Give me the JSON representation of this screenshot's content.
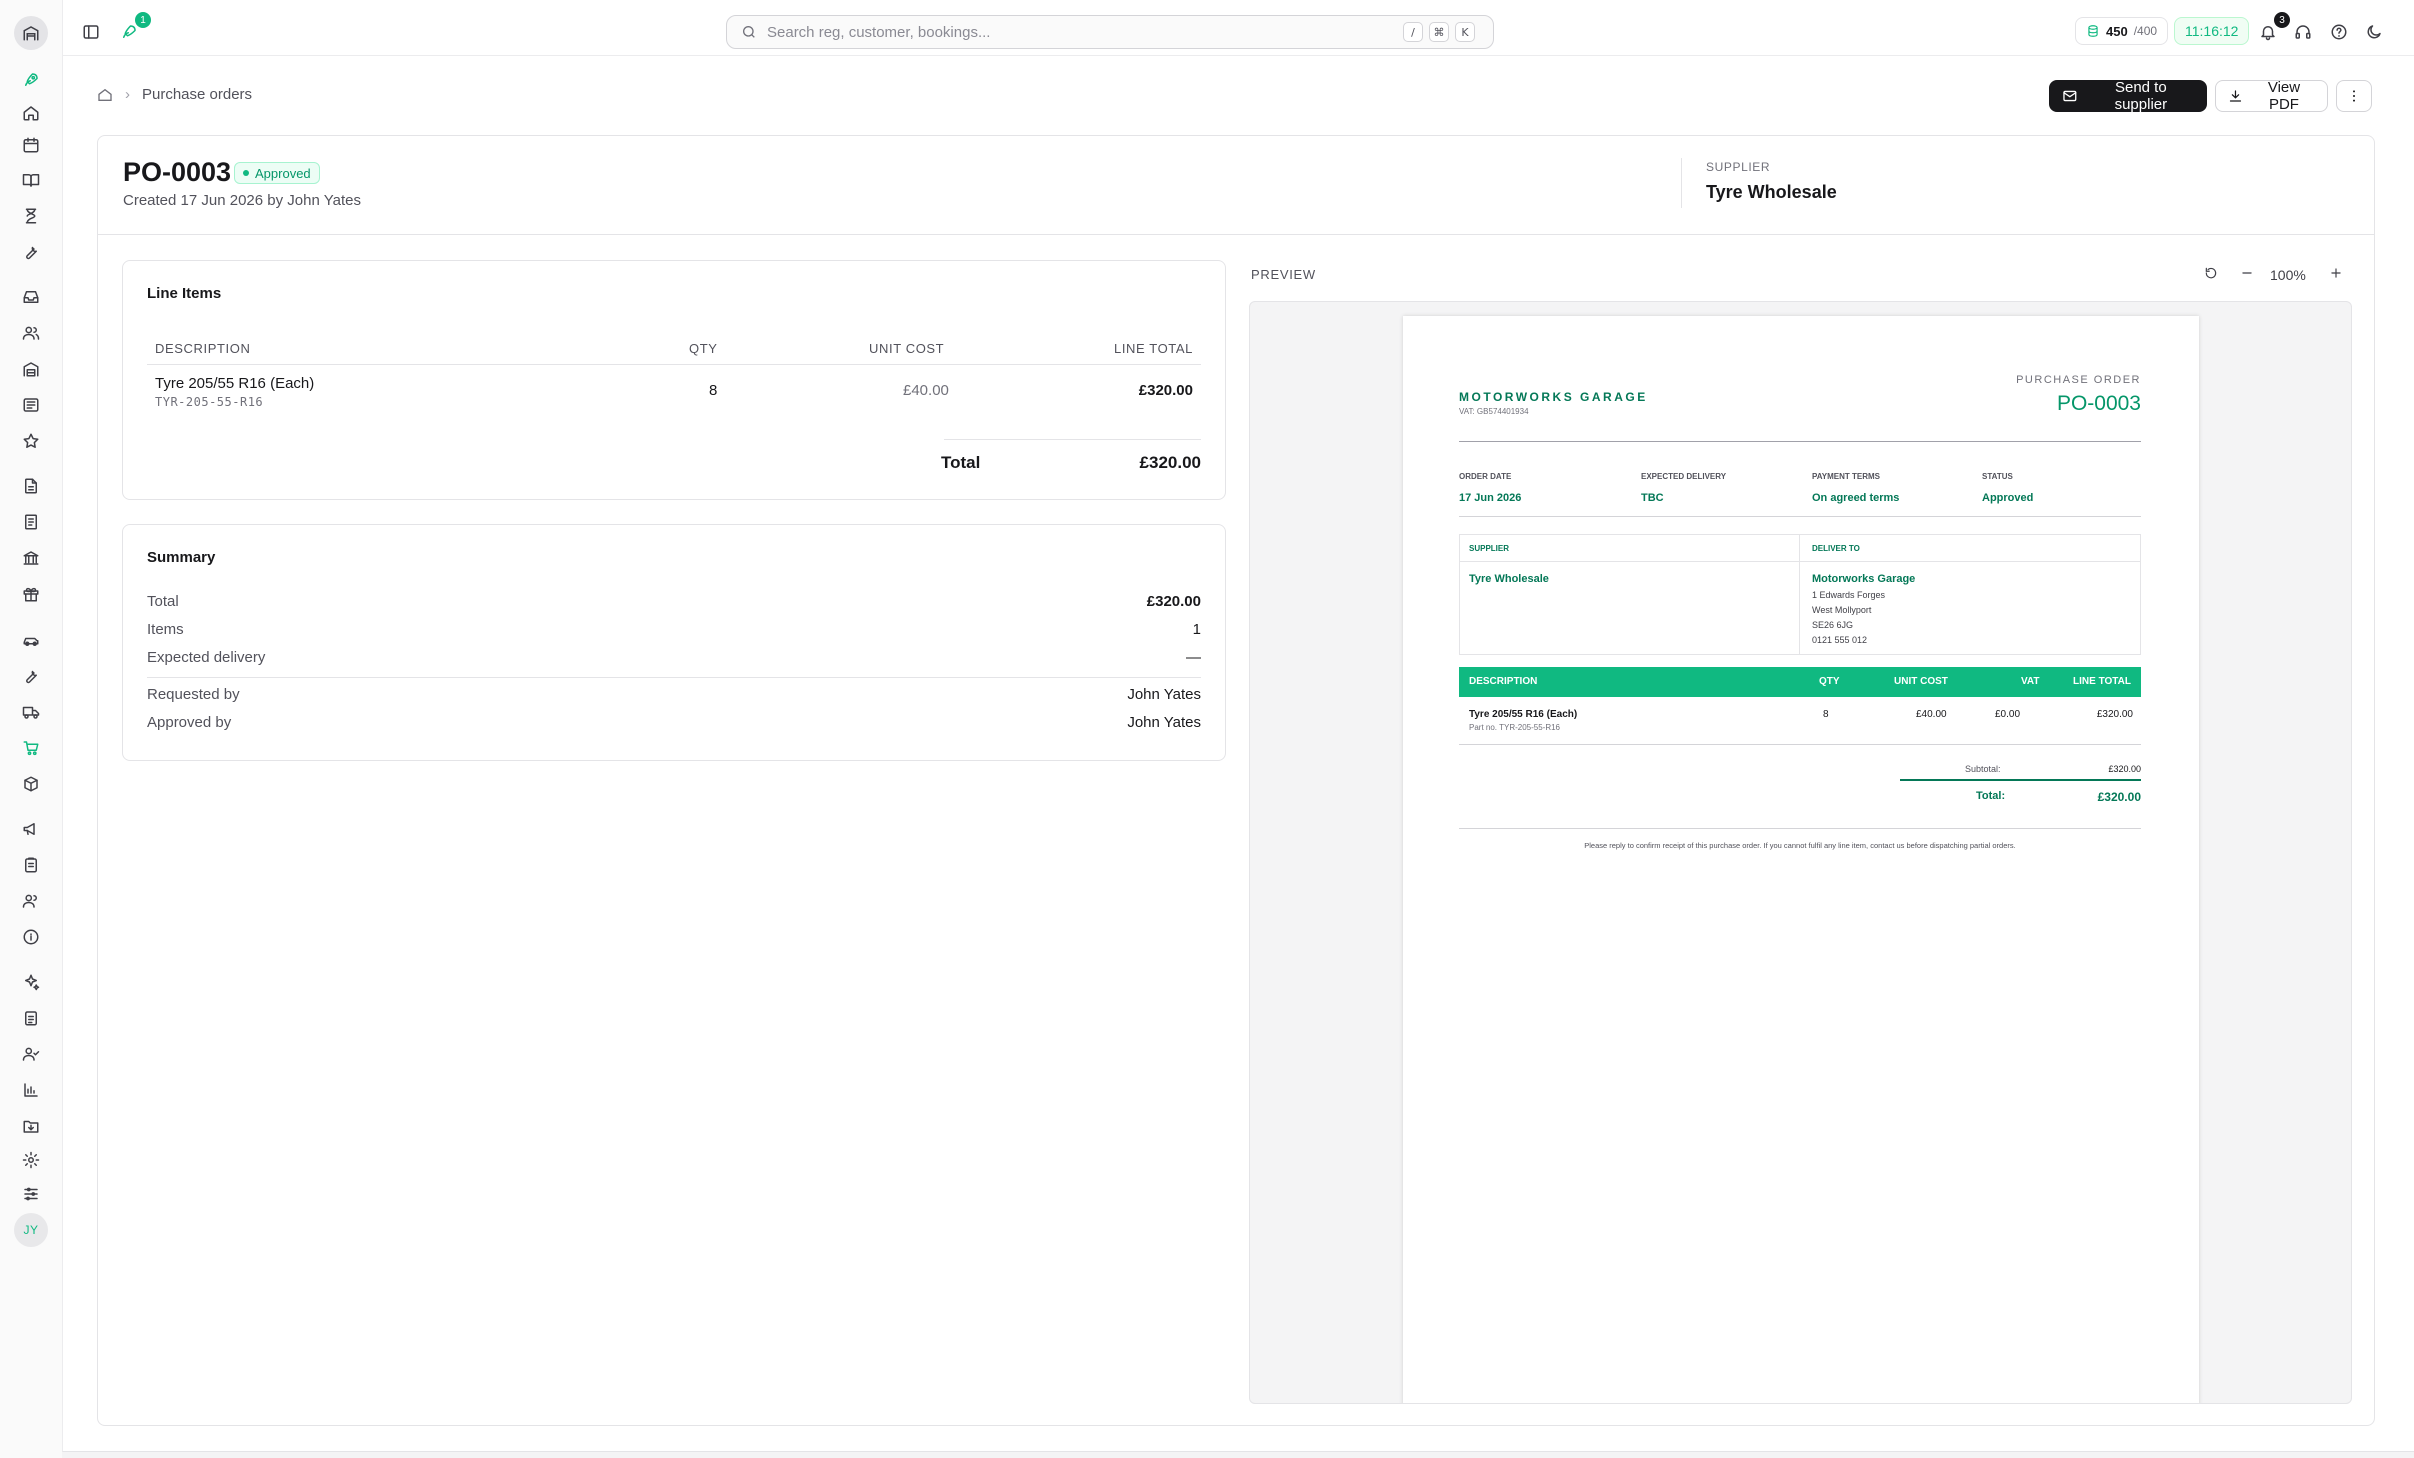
{
  "topbar": {
    "search_placeholder": "Search reg, customer, bookings...",
    "kbd": [
      "/",
      "⌘",
      "K"
    ],
    "rocket_badge": "1",
    "credits_value": "450",
    "credits_max": "/400",
    "clock": "11:16:12",
    "notifications_badge": "3"
  },
  "breadcrumb": {
    "current": "Purchase orders"
  },
  "actions": {
    "send": "Send to supplier",
    "pdf": "View PDF"
  },
  "po": {
    "number": "PO-0003",
    "status": "Approved",
    "created": "Created 17 Jun 2026 by John Yates",
    "supplier_label": "SUPPLIER",
    "supplier_name": "Tyre Wholesale"
  },
  "line_items": {
    "title": "Line Items",
    "headers": {
      "description": "DESCRIPTION",
      "qty": "QTY",
      "unit_cost": "UNIT COST",
      "line_total": "LINE TOTAL"
    },
    "rows": [
      {
        "description": "Tyre 205/55 R16 (Each)",
        "sku": "TYR-205-55-R16",
        "qty": "8",
        "unit_cost": "£40.00",
        "line_total": "£320.00"
      }
    ],
    "total_label": "Total",
    "total_value": "£320.00"
  },
  "summary": {
    "title": "Summary",
    "rows": [
      {
        "label": "Total",
        "value": "£320.00"
      },
      {
        "label": "Items",
        "value": "1"
      },
      {
        "label": "Expected delivery",
        "value": "—"
      },
      {
        "label": "Requested by",
        "value": "John Yates"
      },
      {
        "label": "Approved by",
        "value": "John Yates"
      }
    ]
  },
  "preview": {
    "label": "PREVIEW",
    "zoom": "100%",
    "doc": {
      "company": "MOTORWORKS GARAGE",
      "vat": "VAT: GB574401934",
      "doc_type": "PURCHASE ORDER",
      "po_number": "PO-0003",
      "meta": [
        {
          "label": "ORDER DATE",
          "value": "17 Jun 2026"
        },
        {
          "label": "EXPECTED DELIVERY",
          "value": "TBC"
        },
        {
          "label": "PAYMENT TERMS",
          "value": "On agreed terms"
        },
        {
          "label": "STATUS",
          "value": "Approved"
        }
      ],
      "supplier_label": "SUPPLIER",
      "supplier_name": "Tyre Wholesale",
      "deliver_label": "DELIVER TO",
      "deliver_name": "Motorworks Garage",
      "deliver_lines": [
        "1 Edwards Forges",
        "West Mollyport",
        "SE26 6JG",
        "0121 555 012"
      ],
      "table_headers": {
        "description": "DESCRIPTION",
        "qty": "QTY",
        "unit_cost": "UNIT COST",
        "vat": "VAT",
        "line_total": "LINE TOTAL"
      },
      "row": {
        "description": "Tyre 205/55 R16 (Each)",
        "part": "Part no. TYR-205-55-R16",
        "qty": "8",
        "unit_cost": "£40.00",
        "vat": "£0.00",
        "line_total": "£320.00"
      },
      "subtotal_label": "Subtotal:",
      "subtotal_value": "£320.00",
      "total_label": "Total:",
      "total_value": "£320.00",
      "footer_note": "Please reply to confirm receipt of this purchase order. If you cannot fulfil any line item, contact us before dispatching partial orders."
    }
  },
  "user": {
    "initials": "JY"
  },
  "colors": {
    "accent": "#10b981",
    "accent_dark": "#047857",
    "primary_button": "#18181b"
  }
}
